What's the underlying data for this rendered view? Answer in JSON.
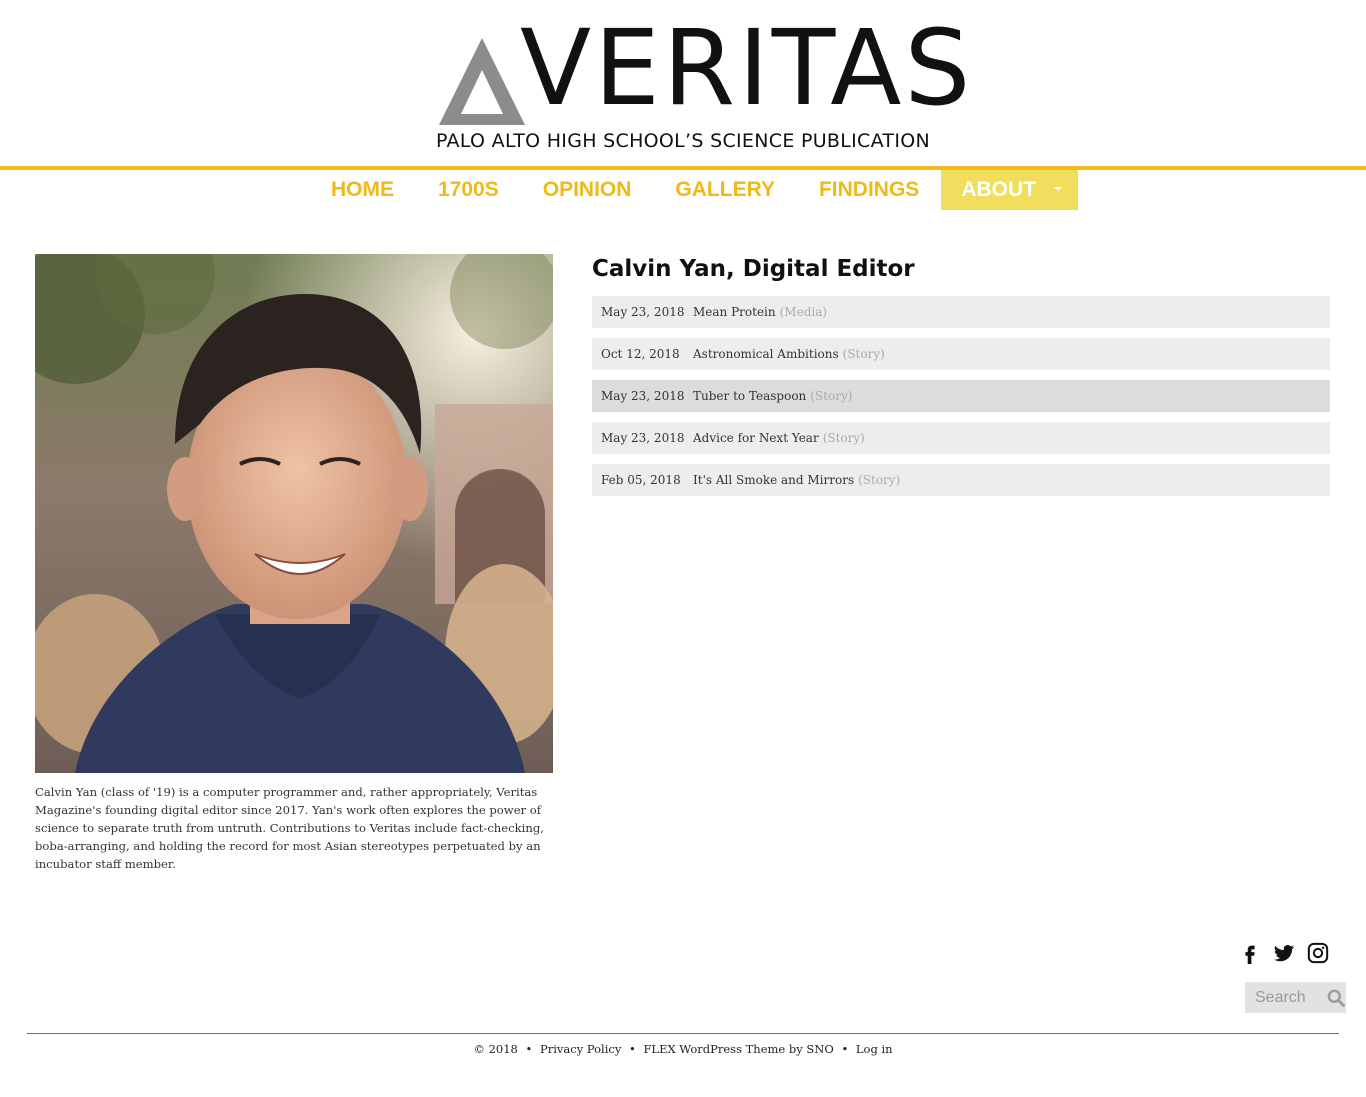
{
  "brand": {
    "name": "VERITAS",
    "tagline": "PALO ALTO HIGH SCHOOL’S SCIENCE PUBLICATION"
  },
  "nav": {
    "items": [
      {
        "label": "HOME"
      },
      {
        "label": "1700S"
      },
      {
        "label": "OPINION"
      },
      {
        "label": "GALLERY"
      },
      {
        "label": "FINDINGS"
      },
      {
        "label": "ABOUT"
      }
    ],
    "active": "ABOUT"
  },
  "author": {
    "title": "Calvin Yan, Digital Editor",
    "bio": "Calvin Yan (class of '19) is a computer programmer and, rather appropriately, Veritas Magazine's founding digital editor since 2017. Yan's work often explores the power of science to separate truth from untruth. Contributions to Veritas include fact-checking, boba-arranging, and holding the record for most Asian stereotypes perpetuated by an incubator staff member."
  },
  "stories": [
    {
      "date": "May 23, 2018",
      "title": "Mean Protein",
      "type": "(Media)"
    },
    {
      "date": "Oct 12, 2018",
      "title": "Astronomical Ambitions",
      "type": "(Story)"
    },
    {
      "date": "May 23, 2018",
      "title": "Tuber to Teaspoon",
      "type": "(Story)"
    },
    {
      "date": "May 23, 2018",
      "title": "Advice for Next Year",
      "type": "(Story)"
    },
    {
      "date": "Feb 05, 2018",
      "title": "It's All Smoke and Mirrors",
      "type": "(Story)"
    }
  ],
  "social": {
    "icons": [
      "facebook-icon",
      "twitter-icon",
      "instagram-icon"
    ]
  },
  "search": {
    "placeholder": "Search"
  },
  "footer": {
    "copyright": "© 2018",
    "privacy": "Privacy Policy",
    "theme": "FLEX WordPress Theme",
    "by": "by",
    "sno": "SNO",
    "login": "Log in",
    "bullet": "•"
  },
  "colors": {
    "accent": "#f3bb1c",
    "nav_active_bg": "#f1de5c",
    "row_bg": "#ededed",
    "row_hover_bg": "#dcdcdc"
  }
}
